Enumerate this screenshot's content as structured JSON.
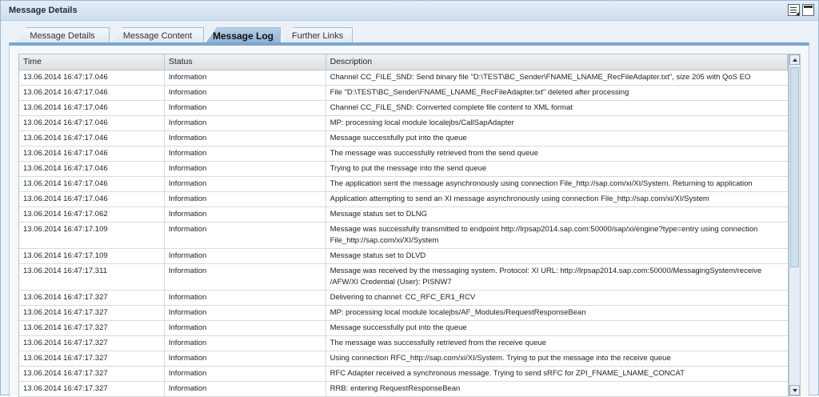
{
  "window": {
    "title": "Message Details"
  },
  "tabs": [
    {
      "label": "Message Details"
    },
    {
      "label": "Message Content"
    },
    {
      "label": "Message Log",
      "active": true
    },
    {
      "label": "Further Links"
    }
  ],
  "table": {
    "columns": [
      "Time",
      "Status",
      "Description"
    ],
    "rows": [
      {
        "time": "13.06.2014 16:47:17.046",
        "status": "Information",
        "description": "Channel CC_FILE_SND: Send binary file  \"D:\\TEST\\BC_Sender\\FNAME_LNAME_RecFileAdapter.txt\", size 205 with QoS EO"
      },
      {
        "time": "13.06.2014 16:47:17.046",
        "status": "Information",
        "description": "File \"D:\\TEST\\BC_Sender\\FNAME_LNAME_RecFileAdapter.txt\" deleted after processing"
      },
      {
        "time": "13.06.2014 16:47:17.046",
        "status": "Information",
        "description": "Channel CC_FILE_SND: Converted complete file content to XML format"
      },
      {
        "time": "13.06.2014 16:47:17.046",
        "status": "Information",
        "description": "MP: processing local module localejbs/CallSapAdapter"
      },
      {
        "time": "13.06.2014 16:47:17.046",
        "status": "Information",
        "description": "Message successfully put into the queue"
      },
      {
        "time": "13.06.2014 16:47:17.046",
        "status": "Information",
        "description": "The message was successfully retrieved from the send queue"
      },
      {
        "time": "13.06.2014 16:47:17.046",
        "status": "Information",
        "description": "Trying to put the message into the send queue"
      },
      {
        "time": "13.06.2014 16:47:17.046",
        "status": "Information",
        "description": "The application sent the message asynchronously using connection File_http://sap.com/xi/XI/System. Returning to application"
      },
      {
        "time": "13.06.2014 16:47:17.046",
        "status": "Information",
        "description": "Application attempting to send an XI message asynchronously using connection File_http://sap.com/xi/XI/System"
      },
      {
        "time": "13.06.2014 16:47:17.062",
        "status": "Information",
        "description": "Message status set to DLNG"
      },
      {
        "time": "13.06.2014 16:47:17.109",
        "status": "Information",
        "description": "Message was successfully transmitted to endpoint http://lrpsap2014.sap.com:50000/sap/xi/engine?type=entry using connection File_http://sap.com/xi/XI/System"
      },
      {
        "time": "13.06.2014 16:47:17.109",
        "status": "Information",
        "description": "Message status set to DLVD"
      },
      {
        "time": "13.06.2014 16:47:17.311",
        "status": "Information",
        "description": "Message was received by the messaging system. Protocol: XI URL: http://lrpsap2014.sap.com:50000/MessagingSystem/receive /AFW/XI Credential (User): PISNW7"
      },
      {
        "time": "13.06.2014 16:47:17.327",
        "status": "Information",
        "description": "Delivering to channel: CC_RFC_ER1_RCV"
      },
      {
        "time": "13.06.2014 16:47:17.327",
        "status": "Information",
        "description": "MP: processing local module localejbs/AF_Modules/RequestResponseBean"
      },
      {
        "time": "13.06.2014 16:47:17.327",
        "status": "Information",
        "description": "Message successfully put into the queue"
      },
      {
        "time": "13.06.2014 16:47:17.327",
        "status": "Information",
        "description": "The message was successfully retrieved from the receive queue"
      },
      {
        "time": "13.06.2014 16:47:17.327",
        "status": "Information",
        "description": "Using connection RFC_http://sap.com/xi/XI/System. Trying to put the message into the receive queue"
      },
      {
        "time": "13.06.2014 16:47:17.327",
        "status": "Information",
        "description": "RFC Adapter received a synchronous message. Trying to send sRFC for ZPI_FNAME_LNAME_CONCAT"
      },
      {
        "time": "13.06.2014 16:47:17.327",
        "status": "Information",
        "description": "RRB: entering RequestResponseBean"
      }
    ]
  }
}
